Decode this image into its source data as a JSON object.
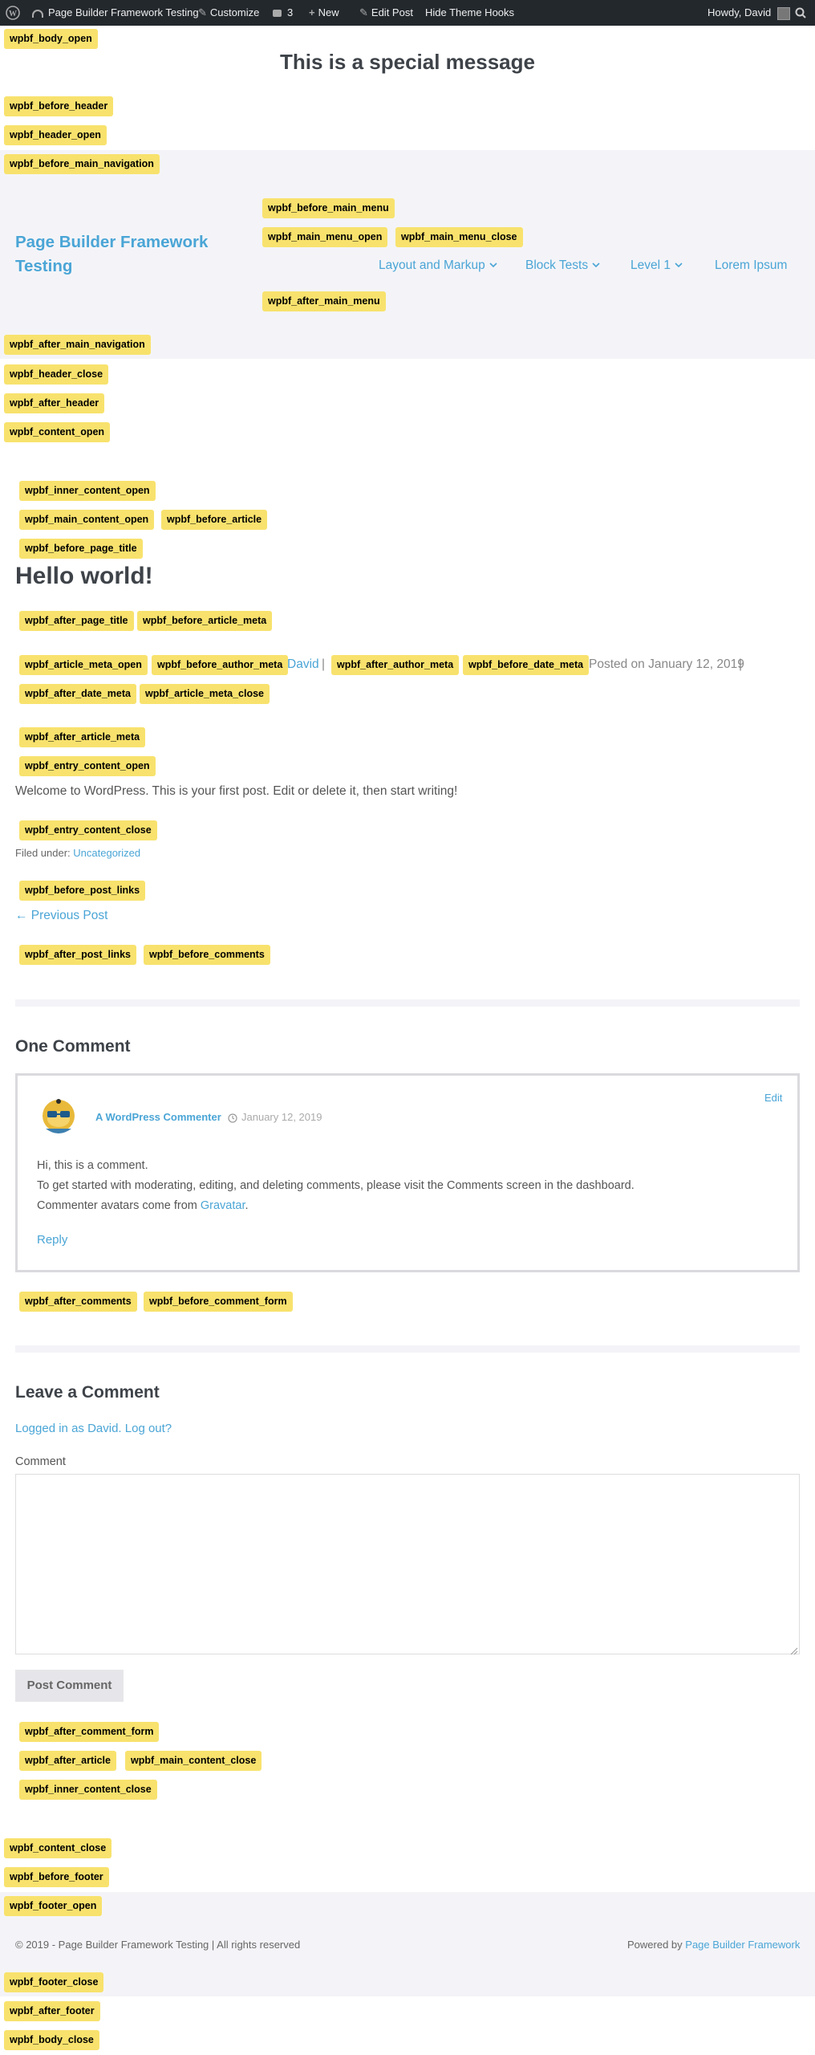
{
  "admin_bar": {
    "site_name": "Page Builder Framework Testing",
    "customize": "Customize",
    "comments_count": "3",
    "new_label": "New",
    "edit_post": "Edit Post",
    "hide_hooks": "Hide Theme Hooks",
    "howdy": "Howdy, David"
  },
  "special_message": "This is a special message",
  "site_title_line1": "Page Builder Framework",
  "site_title_line2": "Testing",
  "nav": {
    "items": [
      {
        "label": "Layout and Markup"
      },
      {
        "label": "Block Tests"
      },
      {
        "label": "Level 1"
      },
      {
        "label": "Lorem Ipsum"
      }
    ]
  },
  "hooks": {
    "body_open": "wpbf_body_open",
    "before_header": "wpbf_before_header",
    "header_open": "wpbf_header_open",
    "before_main_navigation": "wpbf_before_main_navigation",
    "before_main_menu": "wpbf_before_main_menu",
    "main_menu_open": "wpbf_main_menu_open",
    "main_menu_close": "wpbf_main_menu_close",
    "after_main_menu": "wpbf_after_main_menu",
    "after_main_navigation": "wpbf_after_main_navigation",
    "header_close": "wpbf_header_close",
    "after_header": "wpbf_after_header",
    "content_open": "wpbf_content_open",
    "inner_content_open": "wpbf_inner_content_open",
    "main_content_open": "wpbf_main_content_open",
    "before_article": "wpbf_before_article",
    "before_page_title": "wpbf_before_page_title",
    "after_page_title": "wpbf_after_page_title",
    "before_article_meta": "wpbf_before_article_meta",
    "article_meta_open": "wpbf_article_meta_open",
    "before_author_meta": "wpbf_before_author_meta",
    "after_author_meta": "wpbf_after_author_meta",
    "before_date_meta": "wpbf_before_date_meta",
    "after_date_meta": "wpbf_after_date_meta",
    "article_meta_close": "wpbf_article_meta_close",
    "after_article_meta": "wpbf_after_article_meta",
    "entry_content_open": "wpbf_entry_content_open",
    "entry_content_close": "wpbf_entry_content_close",
    "before_post_links": "wpbf_before_post_links",
    "after_post_links": "wpbf_after_post_links",
    "before_comments": "wpbf_before_comments",
    "after_comments": "wpbf_after_comments",
    "before_comment_form": "wpbf_before_comment_form",
    "after_comment_form": "wpbf_after_comment_form",
    "after_article": "wpbf_after_article",
    "main_content_close": "wpbf_main_content_close",
    "inner_content_close": "wpbf_inner_content_close",
    "content_close": "wpbf_content_close",
    "before_footer": "wpbf_before_footer",
    "footer_open": "wpbf_footer_open",
    "footer_close": "wpbf_footer_close",
    "after_footer": "wpbf_after_footer",
    "body_close": "wpbf_body_close"
  },
  "article": {
    "title": "Hello world!",
    "author": "David",
    "meta_sep": "|",
    "date": "Posted on January 12, 2019",
    "date_sep": "|",
    "content": "Welcome to WordPress. This is your first post. Edit or delete it, then start writing!",
    "filed_under_label": "Filed under:",
    "category": "Uncategorized",
    "prev_post": "← Previous Post"
  },
  "comments": {
    "heading": "One Comment",
    "author": "A WordPress Commenter",
    "date": "January 12, 2019",
    "edit": "Edit",
    "line1": "Hi, this is a comment.",
    "line2": "To get started with moderating, editing, and deleting comments, please visit the Comments screen in the dashboard.",
    "line3_prefix": "Commenter avatars come from",
    "gravatar": "Gravatar",
    "line3_suffix": ".",
    "reply": "Reply"
  },
  "comment_form": {
    "heading": "Leave a Comment",
    "logged_in": "Logged in as David.",
    "logout": "Log out?",
    "comment_label": "Comment",
    "submit": "Post Comment"
  },
  "footer": {
    "copyright": "© 2019 - Page Builder Framework Testing | All rights reserved",
    "powered_by": "Powered by",
    "powered_link": "Page Builder Framework"
  },
  "colors": {
    "accent": "#4aa5d6",
    "hook_bg": "#f8e26d",
    "admin_bar": "#23282d",
    "band": "#f4f4f8"
  }
}
